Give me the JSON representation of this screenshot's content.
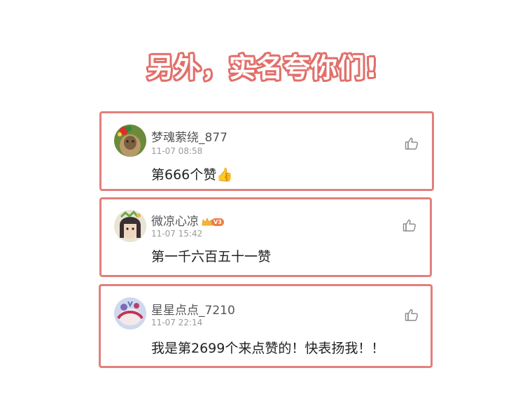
{
  "headline": "另外，实名夸你们!",
  "comments": [
    {
      "username": "梦魂萦绕_877",
      "time": "11-07 08:58",
      "text": "第666个赞",
      "emoji": "👍"
    },
    {
      "username": "微凉心凉",
      "time": "11-07 15:42",
      "text": "第一千六百五十一赞",
      "vip_badge": "V3"
    },
    {
      "username": "星星点点_7210",
      "time": "11-07 22:14",
      "text": "我是第2699个来点赞的！快表扬我！！"
    }
  ],
  "colors": {
    "card_border": "#e2807c",
    "headline_outline": "#e26f6a"
  },
  "icons": {
    "like": "thumbs-up-icon",
    "vip": "crown-icon"
  }
}
